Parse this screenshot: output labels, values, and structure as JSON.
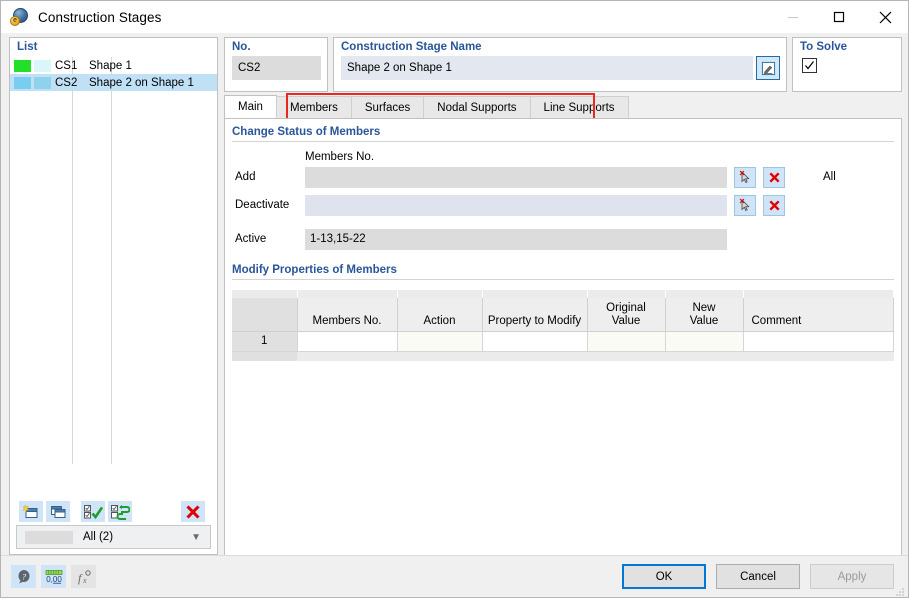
{
  "window": {
    "title": "Construction Stages",
    "icon": "construction-stages-icon",
    "minimize": "minimize-icon",
    "maximize": "maximize-icon",
    "close": "close-icon"
  },
  "list_panel": {
    "header": "List",
    "rows": [
      {
        "no": "CS1",
        "name": "Shape 1",
        "color1": "#22e028",
        "color2": "#d9f7fb",
        "selected": false
      },
      {
        "no": "CS2",
        "name": "Shape 2 on Shape 1",
        "color1": "#78cdf0",
        "color2": "#8fd2ee",
        "selected": true
      }
    ],
    "toolbar": [
      {
        "name": "new-stage-button",
        "title": "New"
      },
      {
        "name": "copy-stage-button",
        "title": "Copy"
      },
      {
        "name": "select-all-button",
        "title": "Select All"
      },
      {
        "name": "toggle-selection-button",
        "title": "Toggle"
      },
      {
        "name": "delete-stage-button",
        "title": "Delete"
      }
    ],
    "filter": {
      "label": "All (2)",
      "arrow": "chevron-down-icon"
    }
  },
  "fields": {
    "no_label": "No.",
    "no_value": "CS2",
    "name_label": "Construction Stage Name",
    "name_value": "Shape 2 on Shape 1",
    "edit_icon": "edit-pencil-icon",
    "solve_label": "To Solve",
    "solve_checked": true
  },
  "tabs": [
    {
      "label": "Main",
      "active": true
    },
    {
      "label": "Members",
      "active": false
    },
    {
      "label": "Surfaces",
      "active": false
    },
    {
      "label": "Nodal Supports",
      "active": false
    },
    {
      "label": "Line Supports",
      "active": false
    }
  ],
  "tab_highlight_color": "#e8291e",
  "change_status": {
    "title": "Change Status of Members",
    "column_header": "Members No.",
    "rows": [
      {
        "label": "Add",
        "value": "",
        "style": "grey",
        "pick_icon": "pick-cursor-icon",
        "clear_icon": "red-x-icon"
      },
      {
        "label": "Deactivate",
        "value": "",
        "style": "lavender",
        "pick_icon": "pick-cursor-icon",
        "clear_icon": "red-x-icon"
      }
    ],
    "active_label": "Active",
    "active_value": "1-13,15-22",
    "all_label": "All",
    "burst_icon": "click-burst-icon",
    "cursor_icon": "mouse-cursor-icon"
  },
  "modify_table": {
    "title": "Modify Properties of Members",
    "columns": [
      "",
      "Members No.",
      "Action",
      "Property to Modify",
      "Original\nValue",
      "New\nValue",
      "Comment"
    ],
    "column_labels": {
      "index": "",
      "members_no": "Members No.",
      "action": "Action",
      "property": "Property to Modify",
      "original_value_l1": "Original",
      "original_value_l2": "Value",
      "new_value_l1": "New",
      "new_value_l2": "Value",
      "comment": "Comment"
    },
    "rows": [
      {
        "index": "1",
        "members_no": "",
        "action": "",
        "property": "",
        "original_value": "",
        "new_value": "",
        "comment": ""
      }
    ]
  },
  "bottom_bar": {
    "icons": [
      {
        "name": "help-button",
        "glyph": "?"
      },
      {
        "name": "units-button",
        "glyph": "0,00"
      },
      {
        "name": "formula-button",
        "glyph": "fx"
      }
    ],
    "ok": "OK",
    "cancel": "Cancel",
    "apply": "Apply"
  }
}
